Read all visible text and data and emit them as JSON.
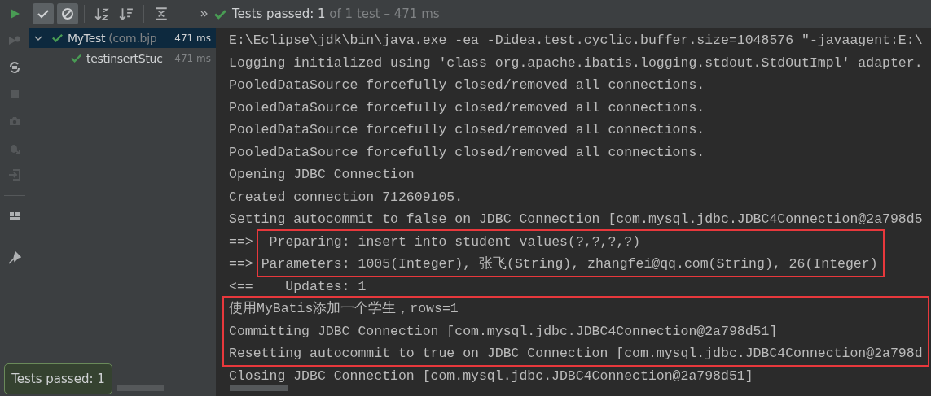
{
  "toolbar": {
    "toggles": [
      {
        "kind": "passed",
        "selected": true
      },
      {
        "kind": "ignored",
        "selected": true
      }
    ],
    "status": {
      "label": "Tests passed: 1",
      "detail": " of 1 test – 471 ms"
    }
  },
  "tree": [
    {
      "name": "MyTest",
      "detail": " (com.bjp",
      "time": "471 ms",
      "selected": true,
      "expanded": true,
      "children": [
        {
          "name": "testinsertStuc",
          "time": "471 ms",
          "selected": false
        }
      ]
    }
  ],
  "console": {
    "blocks": [
      {
        "boxed": false,
        "lines": [
          {
            "text": "E:\\Eclipse\\jdk\\bin\\java.exe -ea -Didea.test.cyclic.buffer.size=1048576 \"-javaagent:E:\\"
          },
          {
            "text": "Logging initialized using 'class org.apache.ibatis.logging.stdout.StdOutImpl' adapter."
          },
          {
            "text": "PooledDataSource forcefully closed/removed all connections."
          },
          {
            "text": "PooledDataSource forcefully closed/removed all connections."
          },
          {
            "text": "PooledDataSource forcefully closed/removed all connections."
          },
          {
            "text": "PooledDataSource forcefully closed/removed all connections."
          },
          {
            "text": "Opening JDBC Connection"
          },
          {
            "text": "Created connection 712609105."
          },
          {
            "text": "Setting autocommit to false on JDBC Connection [com.mysql.jdbc.JDBC4Connection@2a798d5"
          }
        ]
      },
      {
        "boxed": true,
        "lines": [
          {
            "prefix": "==>",
            "text": " Preparing: insert into student values(?,?,?,?)"
          },
          {
            "prefix": "==>",
            "text": "Parameters: 1005(Integer), 张飞(String), zhangfei@qq.com(String), 26(Integer)"
          }
        ]
      },
      {
        "boxed": false,
        "lines": [
          {
            "text": "<==    Updates: 1"
          }
        ]
      },
      {
        "boxed": true,
        "lines": [
          {
            "text": "使用MyBatis添加一个学生，rows=1"
          },
          {
            "text": "Committing JDBC Connection [com.mysql.jdbc.JDBC4Connection@2a798d51]"
          },
          {
            "text": "Resetting autocommit to true on JDBC Connection [com.mysql.jdbc.JDBC4Connection@2a798d"
          }
        ]
      },
      {
        "boxed": false,
        "lines": [
          {
            "text": "Closing JDBC Connection [com.mysql.jdbc.JDBC4Connection@2a798d51]"
          }
        ]
      }
    ]
  },
  "notification": {
    "text": "Tests passed: 1"
  }
}
